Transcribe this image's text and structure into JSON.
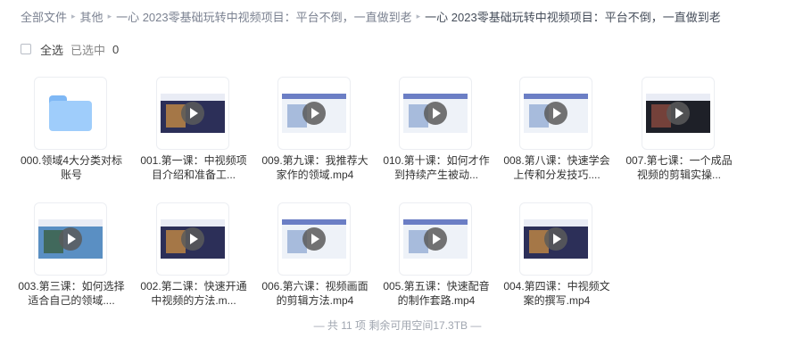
{
  "breadcrumb": {
    "items": [
      "全部文件",
      "其他",
      "一心 2023零基础玩转中视频项目：平台不倒，一直做到老"
    ],
    "current": "一心 2023零基础玩转中视频项目：平台不倒，一直做到老",
    "separator": "▸"
  },
  "selection": {
    "select_all_label": "全选",
    "selected_label": "已选中",
    "selected_count": "0"
  },
  "files": [
    {
      "name": "000.领域4大分类对标账号",
      "type": "folder",
      "icon": "folder-icon"
    },
    {
      "name": "001.第一课：中视频项目介绍和准备工...",
      "type": "video",
      "icon": "play-icon"
    },
    {
      "name": "009.第九课：我推荐大家作的领域.mp4",
      "type": "video",
      "icon": "play-icon"
    },
    {
      "name": "010.第十课：如何才作到持续产生被动...",
      "type": "video",
      "icon": "play-icon"
    },
    {
      "name": "008.第八课：快速学会上传和分发技巧....",
      "type": "video",
      "icon": "play-icon"
    },
    {
      "name": "007.第七课：一个成品视频的剪辑实操...",
      "type": "video",
      "icon": "play-icon"
    },
    {
      "name": "003.第三课：如何选择适合自己的领域....",
      "type": "video",
      "icon": "play-icon"
    },
    {
      "name": "002.第二课：快速开通中视频的方法.m...",
      "type": "video",
      "icon": "play-icon"
    },
    {
      "name": "006.第六课：视频画面的剪辑方法.mp4",
      "type": "video",
      "icon": "play-icon"
    },
    {
      "name": "005.第五课：快速配音的制作套路.mp4",
      "type": "video",
      "icon": "play-icon"
    },
    {
      "name": "004.第四课：中视频文案的撰写.mp4",
      "type": "video",
      "icon": "play-icon"
    }
  ],
  "footer": {
    "text": "— 共 11 项 剩余可用空间17.3TB —"
  },
  "colors": {
    "folder": "#9fcdfb",
    "link": "#7b8291",
    "muted": "#a0a6b0"
  }
}
